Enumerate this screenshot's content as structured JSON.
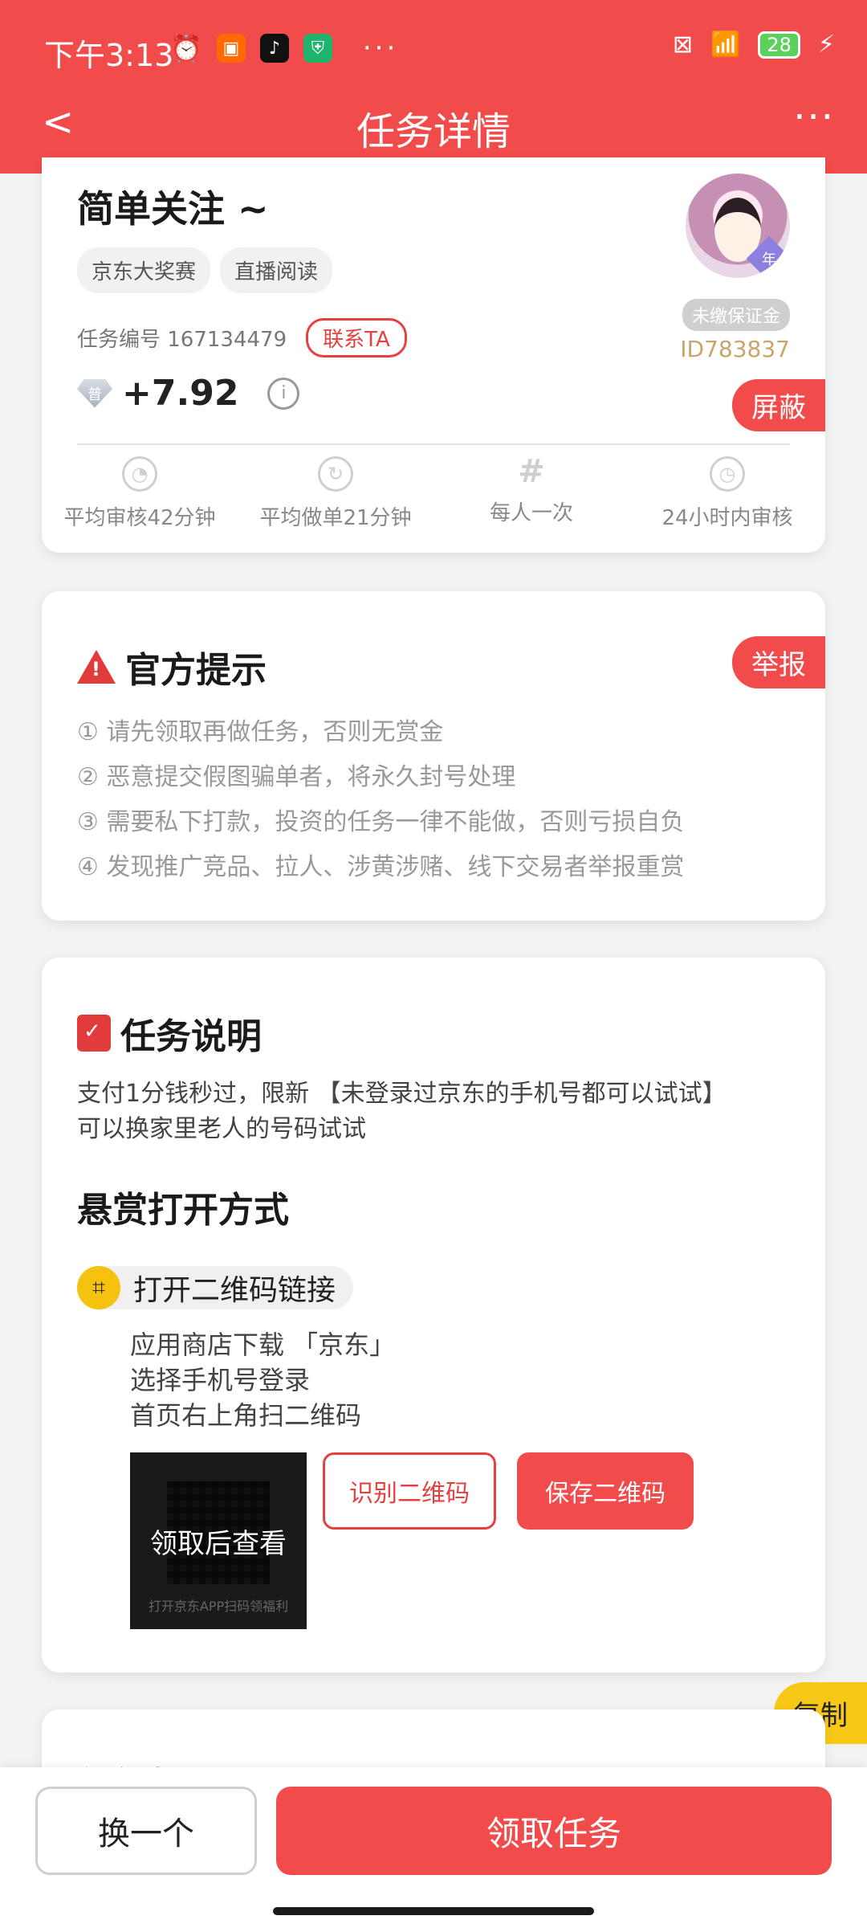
{
  "status_bar": {
    "time": "下午3:13",
    "battery": "28",
    "dots": "···"
  },
  "nav": {
    "back": "<",
    "title": "任务详情",
    "more": "···"
  },
  "task": {
    "title": "简单关注 ~",
    "tags": [
      "京东大奖赛",
      "直播阅读"
    ],
    "task_no": "任务编号 167134479",
    "contact_label": "联系TA",
    "reward_badge": "普",
    "reward": "+7.92",
    "info_icon": "i",
    "deposit_label": "未缴保证金",
    "user_id": "ID783837",
    "avatar_badge": "年",
    "block_label": "屏蔽",
    "stats": [
      {
        "icon": "clock-check-icon",
        "label": "平均审核42分钟"
      },
      {
        "icon": "clock-refresh-icon",
        "label": "平均做单21分钟"
      },
      {
        "icon": "hash-icon",
        "label": "每人一次"
      },
      {
        "icon": "clock-icon",
        "label": "24小时内审核"
      }
    ]
  },
  "notice": {
    "title": "官方提示",
    "report_label": "举报",
    "tips": [
      "① 请先领取再做任务，否则无赏金",
      "② 恶意提交假图骗单者，将永久封号处理",
      "③ 需要私下打款，投资的任务一律不能做，否则亏损自负",
      "④ 发现推广竞品、拉人、涉黄涉赌、线下交易者举报重赏"
    ]
  },
  "description": {
    "title": "任务说明",
    "text_line1": "支付1分钱秒过，限新 【未登录过京东的手机号都可以试试】",
    "text_line2": "可以换家里老人的号码试试",
    "open_title": "悬赏打开方式",
    "open_link_label": "打开二维码链接",
    "steps": [
      "应用商店下载 「京东」",
      "选择手机号登录",
      "首页右上角扫二维码"
    ],
    "qr_overlay": "领取后查看",
    "qr_caption": "打开京东APP扫码领福利",
    "recognize_label": "识别二维码",
    "save_label": "保存二维码"
  },
  "copy_label": "复制",
  "steps_card": {
    "title": "任务步骤"
  },
  "bottom": {
    "switch_label": "换一个",
    "claim_label": "领取任务"
  },
  "colors": {
    "primary": "#f24b4b",
    "accent_yellow": "#f8c816",
    "uid_gold": "#c9a56a"
  }
}
